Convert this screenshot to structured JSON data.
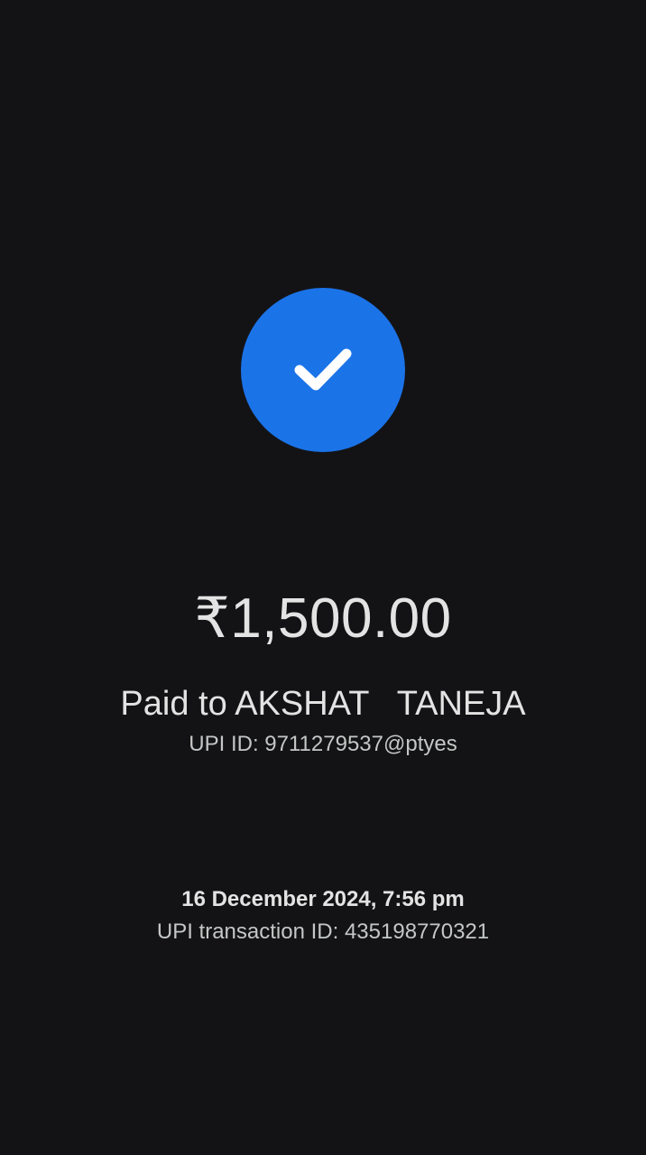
{
  "status": {
    "icon": "check-icon",
    "accent_color": "#1b73e8",
    "state": "success"
  },
  "payment": {
    "amount": "₹1,500.00",
    "paid_to": "Paid to AKSHAT   TANEJA",
    "upi_id": "UPI ID: 9711279537@ptyes"
  },
  "transaction": {
    "datetime": "16 December 2024, 7:56 pm",
    "upi_transaction_id": "UPI transaction ID: 435198770321"
  }
}
